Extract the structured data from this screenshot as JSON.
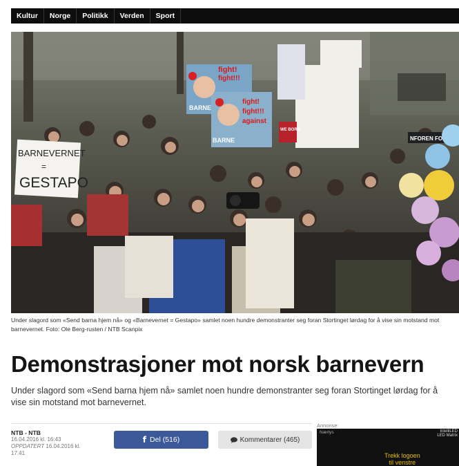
{
  "nav": {
    "items": [
      "Kultur",
      "Norge",
      "Politikk",
      "Verden",
      "Sport"
    ]
  },
  "hero_image": {
    "signs": {
      "left_line1": "BARNEVERNET",
      "left_line2": "GESTAPO",
      "poster_line1": "fight!",
      "poster_line2": "fight!!!",
      "poster_line3": "against",
      "poster_tag": "BARNE",
      "small_red_sign": "WE BORN",
      "right_banner": "NFOREN FOR"
    }
  },
  "caption": "Under slagord som «Send barna hjem nå» og «Barnevernet = Gestapo» samlet noen hundre demonstranter seg foran Stortinget lørdag for å vise sin motstand mot barnevernet. Foto: Ole Berg-rusten / NTB Scanpix",
  "article": {
    "title": "Demonstrasjoner mot norsk barnevern",
    "lead": "Under slagord som «Send barna hjem nå» samlet noen hundre demonstranter seg foran Stortinget lørdag for å vise sin motstand mot barnevernet.",
    "source": "NTB - NTB",
    "published": "16.04.2016 kl. 16:43",
    "updated_label": "OPPDATERT",
    "updated": "16.04.2016 kl. 17:41"
  },
  "actions": {
    "share_icon": "facebook-icon",
    "share_label": "Del (516)",
    "comments_icon": "speech-bubble-icon",
    "comments_label": "Kommentarer (465)"
  },
  "ad": {
    "label": "Annonse:",
    "brand": "Nærlys",
    "logo_line1": "IntelliLED",
    "logo_line2": "LED Matrix",
    "cta_line1": "Trekk logoen",
    "cta_line2": "til venstre"
  },
  "colors": {
    "nav_bg": "#0d0d0d",
    "facebook_blue": "#3b5998",
    "comments_bg": "#e4e4e4",
    "ad_accent": "#e8c000"
  }
}
